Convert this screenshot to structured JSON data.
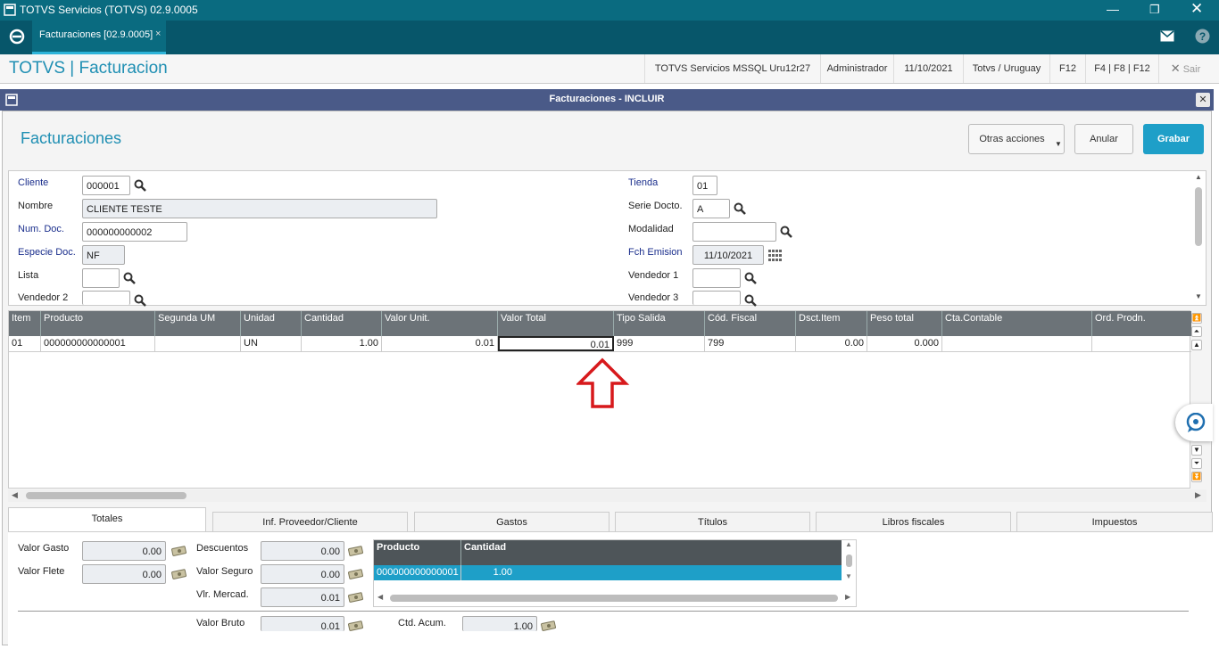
{
  "window": {
    "title": "TOTVS Servicios (TOTVS) 02.9.0005"
  },
  "tabbar": {
    "tab_label": "Facturaciones [02.9.0005]",
    "tab_close": "×"
  },
  "header": {
    "brand": "TOTVS | Facturacion",
    "server": "TOTVS Servicios MSSQL Uru12r27",
    "user": "Administrador",
    "date": "11/10/2021",
    "company": "Totvs / Uruguay",
    "f12": "F12",
    "shortcuts": "F4 | F8 | F12",
    "exit": "Sair"
  },
  "dialog": {
    "title": "Facturaciones - INCLUIR",
    "heading": "Facturaciones",
    "otras_acciones": "Otras acciones",
    "anular": "Anular",
    "grabar": "Grabar"
  },
  "form": {
    "cliente_label": "Cliente",
    "cliente_value": "000001",
    "nombre_label": "Nombre",
    "nombre_value": "CLIENTE TESTE",
    "numdoc_label": "Num. Doc.",
    "numdoc_value": "000000000002",
    "especie_label": "Especie Doc.",
    "especie_value": "NF",
    "lista_label": "Lista",
    "lista_value": "",
    "vendedor2_label": "Vendedor 2",
    "tienda_label": "Tienda",
    "tienda_value": "01",
    "serie_label": "Serie Docto.",
    "serie_value": "A",
    "modalidad_label": "Modalidad",
    "modalidad_value": "",
    "fchemision_label": "Fch Emision",
    "fchemision_value": "11/10/2021",
    "vendedor1_label": "Vendedor 1",
    "vendedor3_label": "Vendedor 3"
  },
  "grid": {
    "headers": [
      "Item",
      "Producto",
      "Segunda UM",
      "Unidad",
      "Cantidad",
      "Valor Unit.",
      "Valor Total",
      "Tipo Salida",
      "Cód. Fiscal",
      "Dsct.Item",
      "Peso total",
      "Cta.Contable",
      "Ord. Prodn."
    ],
    "row": [
      "01",
      "000000000000001",
      "",
      "UN",
      "1.00",
      "0.01",
      "0.01",
      "999",
      "799",
      "0.00",
      "0.000",
      "",
      ""
    ]
  },
  "tabs": [
    "Totales",
    "Inf. Proveedor/Cliente",
    "Gastos",
    "Títulos",
    "Libros fiscales",
    "Impuestos"
  ],
  "totales": {
    "valor_gasto_label": "Valor Gasto",
    "valor_gasto": "0.00",
    "valor_flete_label": "Valor Flete",
    "valor_flete": "0.00",
    "descuentos_label": "Descuentos",
    "descuentos": "0.00",
    "valor_seguro_label": "Valor Seguro",
    "valor_seguro": "0.00",
    "vlr_mercad_label": "Vlr. Mercad.",
    "vlr_mercad": "0.01",
    "valor_bruto_label": "Valor Bruto",
    "valor_bruto": "0.01",
    "ctd_acum_label": "Ctd. Acum.",
    "ctd_acum": "1.00"
  },
  "mini_grid": {
    "headers": [
      "Producto",
      "Cantidad"
    ],
    "row": [
      "000000000000001",
      "1.00"
    ]
  },
  "colors": {
    "accent": "#1f8fb3",
    "titlebar": "#0a6b80",
    "grabar": "#1e9fc8",
    "arrow": "#d7191c"
  }
}
